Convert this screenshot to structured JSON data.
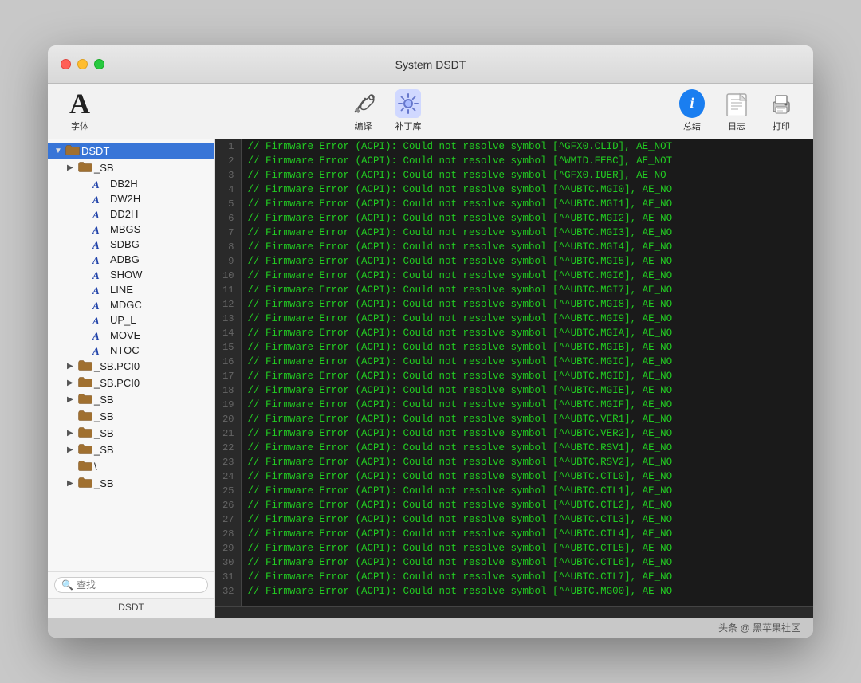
{
  "window": {
    "title": "System DSDT"
  },
  "toolbar": {
    "font_label": "字体",
    "compile_label": "编译",
    "patchlib_label": "补丁库",
    "summary_label": "总结",
    "log_label": "日志",
    "print_label": "打印",
    "font_char": "A"
  },
  "sidebar": {
    "root_label": "DSDT",
    "search_placeholder": "查找",
    "footer_label": "DSDT",
    "items": [
      {
        "id": "dsdt",
        "label": "DSDT",
        "type": "root",
        "indent": 0,
        "expanded": true,
        "has_arrow": true
      },
      {
        "id": "sb1",
        "label": "_SB",
        "type": "folder",
        "indent": 1,
        "expanded": false,
        "has_arrow": true
      },
      {
        "id": "db2h",
        "label": "DB2H",
        "type": "func",
        "indent": 2,
        "has_arrow": false
      },
      {
        "id": "dw2h",
        "label": "DW2H",
        "type": "func",
        "indent": 2,
        "has_arrow": false
      },
      {
        "id": "dd2h",
        "label": "DD2H",
        "type": "func",
        "indent": 2,
        "has_arrow": false
      },
      {
        "id": "mbgs",
        "label": "MBGS",
        "type": "func",
        "indent": 2,
        "has_arrow": false
      },
      {
        "id": "sdbg",
        "label": "SDBG",
        "type": "func",
        "indent": 2,
        "has_arrow": false
      },
      {
        "id": "adbg",
        "label": "ADBG",
        "type": "func",
        "indent": 2,
        "has_arrow": false
      },
      {
        "id": "show",
        "label": "SHOW",
        "type": "func",
        "indent": 2,
        "has_arrow": false
      },
      {
        "id": "line",
        "label": "LINE",
        "type": "func",
        "indent": 2,
        "has_arrow": false
      },
      {
        "id": "mdgc",
        "label": "MDGC",
        "type": "func",
        "indent": 2,
        "has_arrow": false
      },
      {
        "id": "up_l",
        "label": "UP_L",
        "type": "func",
        "indent": 2,
        "has_arrow": false
      },
      {
        "id": "move",
        "label": "MOVE",
        "type": "func",
        "indent": 2,
        "has_arrow": false
      },
      {
        "id": "ntoc",
        "label": "NTOC",
        "type": "func",
        "indent": 2,
        "has_arrow": false
      },
      {
        "id": "sbpci0a",
        "label": "_SB.PCI0",
        "type": "folder",
        "indent": 1,
        "expanded": false,
        "has_arrow": true
      },
      {
        "id": "sbpci0b",
        "label": "_SB.PCI0",
        "type": "folder",
        "indent": 1,
        "expanded": false,
        "has_arrow": true
      },
      {
        "id": "sb2",
        "label": "_SB",
        "type": "folder",
        "indent": 1,
        "expanded": false,
        "has_arrow": true
      },
      {
        "id": "sb3",
        "label": "_SB",
        "type": "folder",
        "indent": 1,
        "has_arrow": false
      },
      {
        "id": "sb4",
        "label": "_SB",
        "type": "folder",
        "indent": 1,
        "expanded": false,
        "has_arrow": true
      },
      {
        "id": "sb5",
        "label": "_SB",
        "type": "folder",
        "indent": 1,
        "expanded": false,
        "has_arrow": true
      },
      {
        "id": "backslash",
        "label": "\\",
        "type": "folder",
        "indent": 1,
        "has_arrow": false
      },
      {
        "id": "sb6",
        "label": "_SB",
        "type": "folder",
        "indent": 1,
        "expanded": false,
        "has_arrow": true
      }
    ]
  },
  "code": {
    "lines": [
      "// Firmware Error (ACPI): Could not resolve symbol [^GFX0.CLID], AE_NOT",
      "// Firmware Error (ACPI): Could not resolve symbol [^WMID.FEBC], AE_NOT",
      "// Firmware Error (ACPI): Could not resolve symbol [^GFX0.IUER], AE_NO",
      "// Firmware Error (ACPI): Could not resolve symbol [^^UBTC.MGI0], AE_NO",
      "// Firmware Error (ACPI): Could not resolve symbol [^^UBTC.MGI1], AE_NO",
      "// Firmware Error (ACPI): Could not resolve symbol [^^UBTC.MGI2], AE_NO",
      "// Firmware Error (ACPI): Could not resolve symbol [^^UBTC.MGI3], AE_NO",
      "// Firmware Error (ACPI): Could not resolve symbol [^^UBTC.MGI4], AE_NO",
      "// Firmware Error (ACPI): Could not resolve symbol [^^UBTC.MGI5], AE_NO",
      "// Firmware Error (ACPI): Could not resolve symbol [^^UBTC.MGI6], AE_NO",
      "// Firmware Error (ACPI): Could not resolve symbol [^^UBTC.MGI7], AE_NO",
      "// Firmware Error (ACPI): Could not resolve symbol [^^UBTC.MGI8], AE_NO",
      "// Firmware Error (ACPI): Could not resolve symbol [^^UBTC.MGI9], AE_NO",
      "// Firmware Error (ACPI): Could not resolve symbol [^^UBTC.MGIA], AE_NO",
      "// Firmware Error (ACPI): Could not resolve symbol [^^UBTC.MGIB], AE_NO",
      "// Firmware Error (ACPI): Could not resolve symbol [^^UBTC.MGIC], AE_NO",
      "// Firmware Error (ACPI): Could not resolve symbol [^^UBTC.MGID], AE_NO",
      "// Firmware Error (ACPI): Could not resolve symbol [^^UBTC.MGIE], AE_NO",
      "// Firmware Error (ACPI): Could not resolve symbol [^^UBTC.MGIF], AE_NO",
      "// Firmware Error (ACPI): Could not resolve symbol [^^UBTC.VER1], AE_NO",
      "// Firmware Error (ACPI): Could not resolve symbol [^^UBTC.VER2], AE_NO",
      "// Firmware Error (ACPI): Could not resolve symbol [^^UBTC.RSV1], AE_NO",
      "// Firmware Error (ACPI): Could not resolve symbol [^^UBTC.RSV2], AE_NO",
      "// Firmware Error (ACPI): Could not resolve symbol [^^UBTC.CTL0], AE_NO",
      "// Firmware Error (ACPI): Could not resolve symbol [^^UBTC.CTL1], AE_NO",
      "// Firmware Error (ACPI): Could not resolve symbol [^^UBTC.CTL2], AE_NO",
      "// Firmware Error (ACPI): Could not resolve symbol [^^UBTC.CTL3], AE_NO",
      "// Firmware Error (ACPI): Could not resolve symbol [^^UBTC.CTL4], AE_NO",
      "// Firmware Error (ACPI): Could not resolve symbol [^^UBTC.CTL5], AE_NO",
      "// Firmware Error (ACPI): Could not resolve symbol [^^UBTC.CTL6], AE_NO",
      "// Firmware Error (ACPI): Could not resolve symbol [^^UBTC.CTL7], AE_NO",
      "// Firmware Error (ACPI): Could not resolve symbol [^^UBTC.MG00], AE_NO",
      ""
    ]
  },
  "attribution": {
    "text": "头条 @ 黑苹果社区"
  }
}
